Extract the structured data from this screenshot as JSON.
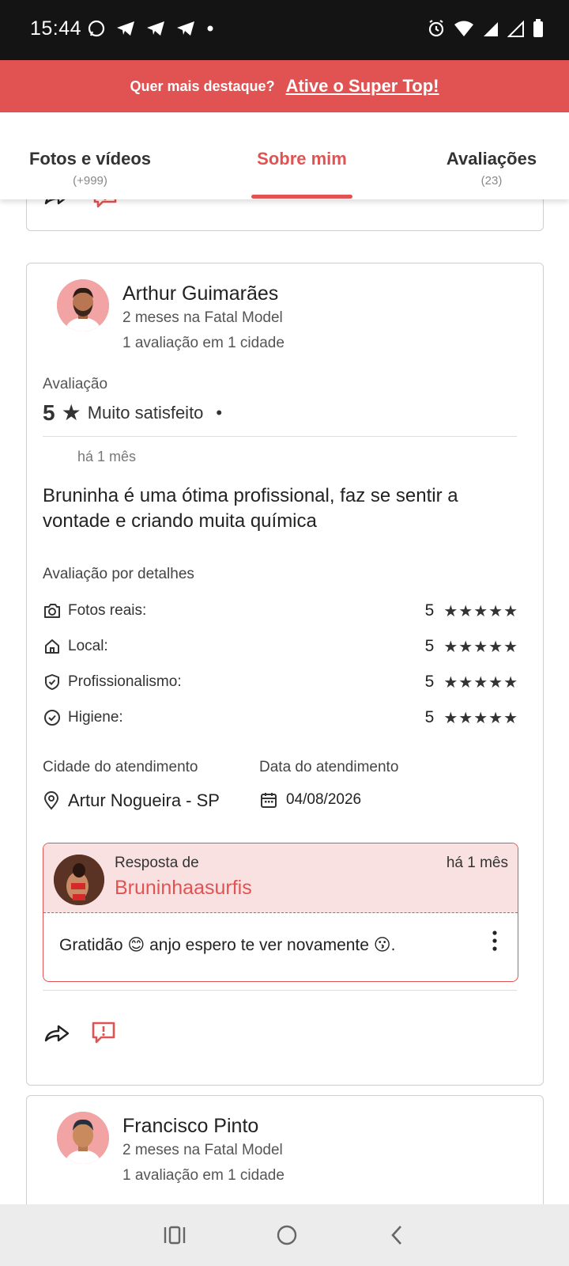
{
  "status_bar": {
    "time": "15:44"
  },
  "banner": {
    "text": "Quer mais destaque?",
    "link": "Ative o Super Top!"
  },
  "tabs": [
    {
      "label": "Fotos e vídeos",
      "count": "(+999)"
    },
    {
      "label": "Sobre mim",
      "count": ""
    },
    {
      "label": "Avaliações",
      "count": "(23)"
    }
  ],
  "review": {
    "reviewer_name": "Arthur Guimarães",
    "reviewer_since": "2 meses na Fatal Model",
    "reviewer_reviews": "1 avaliação em 1 cidade",
    "rating_title": "Avaliação",
    "rating_score": "5",
    "rating_label": "Muito satisfeito",
    "time_ago": "há 1 mês",
    "text": "Bruninha é uma ótima profissional, faz se sentir a vontade e criando muita química",
    "details_title": "Avaliação por detalhes",
    "details": [
      {
        "label": "Fotos reais:",
        "score": "5",
        "stars": "★★★★★"
      },
      {
        "label": "Local:",
        "score": "5",
        "stars": "★★★★★"
      },
      {
        "label": "Profissionalismo:",
        "score": "5",
        "stars": "★★★★★"
      },
      {
        "label": "Higiene:",
        "score": "5",
        "stars": "★★★★★"
      }
    ],
    "city_label": "Cidade do atendimento",
    "city": "Artur Nogueira - SP",
    "date_label": "Data do atendimento",
    "date": "04/08/2026",
    "reply": {
      "from_label": "Resposta de",
      "author": "Bruninhaasurfis",
      "time_ago": "há 1 mês",
      "text": "Gratidão 😊 anjo espero te ver novamente 😗."
    }
  },
  "next_review": {
    "reviewer_name": "Francisco Pinto",
    "reviewer_since": "2 meses na Fatal Model",
    "reviewer_reviews": "1 avaliação em 1 cidade"
  },
  "colors": {
    "accent": "#e15353",
    "reply_bg": "#fae1e1"
  }
}
